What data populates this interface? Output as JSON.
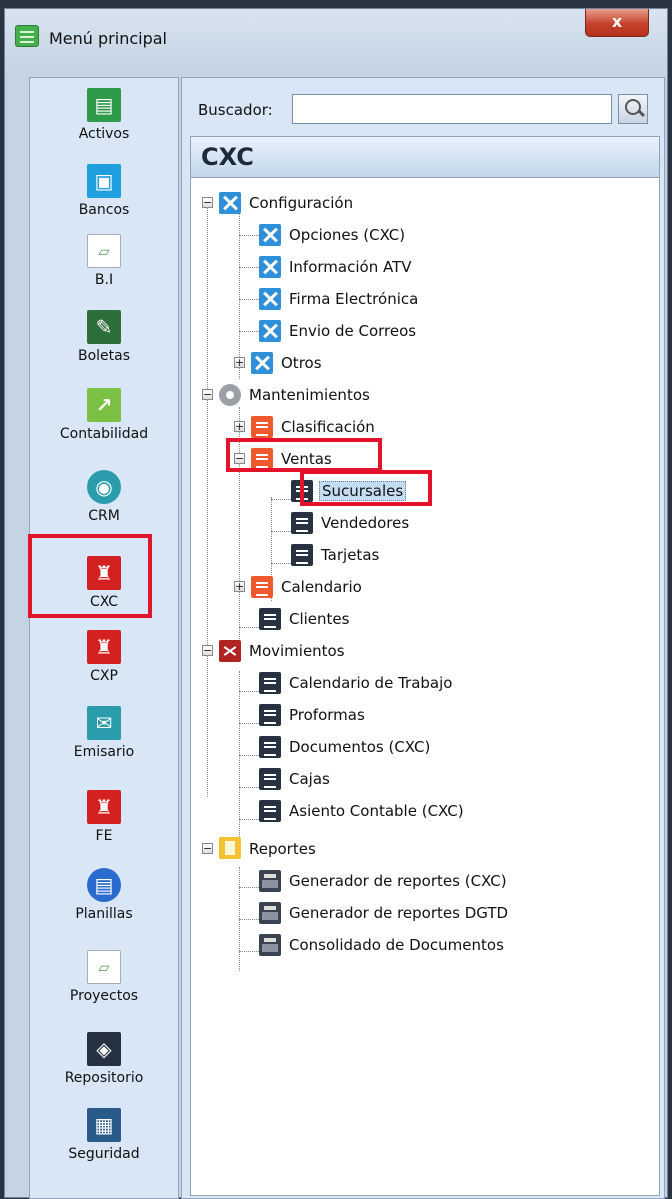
{
  "window": {
    "title": "Menú principal",
    "close_label": "x"
  },
  "sidebar": {
    "items": [
      {
        "label": "Activos",
        "icon": "cash-register-icon",
        "color": "#2e9a4a",
        "glyph": "▤"
      },
      {
        "label": "Bancos",
        "icon": "briefcase-icon",
        "color": "#1f9fe0",
        "glyph": "▣"
      },
      {
        "label": "B.I",
        "icon": "broken-image-icon",
        "color": "#ffffff",
        "glyph": "▱"
      },
      {
        "label": "Boletas",
        "icon": "ticket-icon",
        "color": "#2e6e3a",
        "glyph": "✎"
      },
      {
        "label": "Contabilidad",
        "icon": "chart-icon",
        "color": "#7ac043",
        "glyph": "↗"
      },
      {
        "label": "CRM",
        "icon": "globe-icon",
        "color": "#2a9cab",
        "glyph": "◉"
      },
      {
        "label": "CXC",
        "icon": "collector-icon",
        "color": "#d42020",
        "glyph": "♜"
      },
      {
        "label": "CXP",
        "icon": "payer-icon",
        "color": "#d42020",
        "glyph": "♜"
      },
      {
        "label": "Emisario",
        "icon": "mail-icon",
        "color": "#2a9cab",
        "glyph": "✉"
      },
      {
        "label": "FE",
        "icon": "invoice-icon",
        "color": "#d42020",
        "glyph": "♜"
      },
      {
        "label": "Planillas",
        "icon": "payroll-icon",
        "color": "#2a6bd0",
        "glyph": "▤"
      },
      {
        "label": "Proyectos",
        "icon": "broken-image-icon",
        "color": "#ffffff",
        "glyph": "▱"
      },
      {
        "label": "Repositorio",
        "icon": "box-icon",
        "color": "#263142",
        "glyph": "◈"
      },
      {
        "label": "Seguridad",
        "icon": "factory-icon",
        "color": "#2a5a8a",
        "glyph": "▦"
      }
    ]
  },
  "search": {
    "label": "Buscador:",
    "value": ""
  },
  "module": {
    "title": "CXC"
  },
  "tree": {
    "configuracion": "Configuración",
    "opciones": "Opciones (CXC)",
    "info_atv": "Información ATV",
    "firma": "Firma Electrónica",
    "envio": "Envio de Correos",
    "otros": "Otros",
    "mantenimientos": "Mantenimientos",
    "clasificacion": "Clasificación",
    "ventas": "Ventas",
    "sucursales": "Sucursales",
    "vendedores": "Vendedores",
    "tarjetas": "Tarjetas",
    "calendario": "Calendario",
    "clientes": "Clientes",
    "movimientos": "Movimientos",
    "calendario_trabajo": "Calendario de Trabajo",
    "proformas": "Proformas",
    "documentos": "Documentos (CXC)",
    "cajas": "Cajas",
    "asiento": "Asiento Contable (CXC)",
    "reportes": "Reportes",
    "gen_reportes": "Generador de reportes (CXC)",
    "gen_dgtd": "Generador de reportes DGTD",
    "consolidado": "Consolidado de Documentos"
  },
  "colors": {
    "highlight": "#e3132b",
    "selection": "#c5ddf3",
    "header": "#c2d6ec"
  }
}
